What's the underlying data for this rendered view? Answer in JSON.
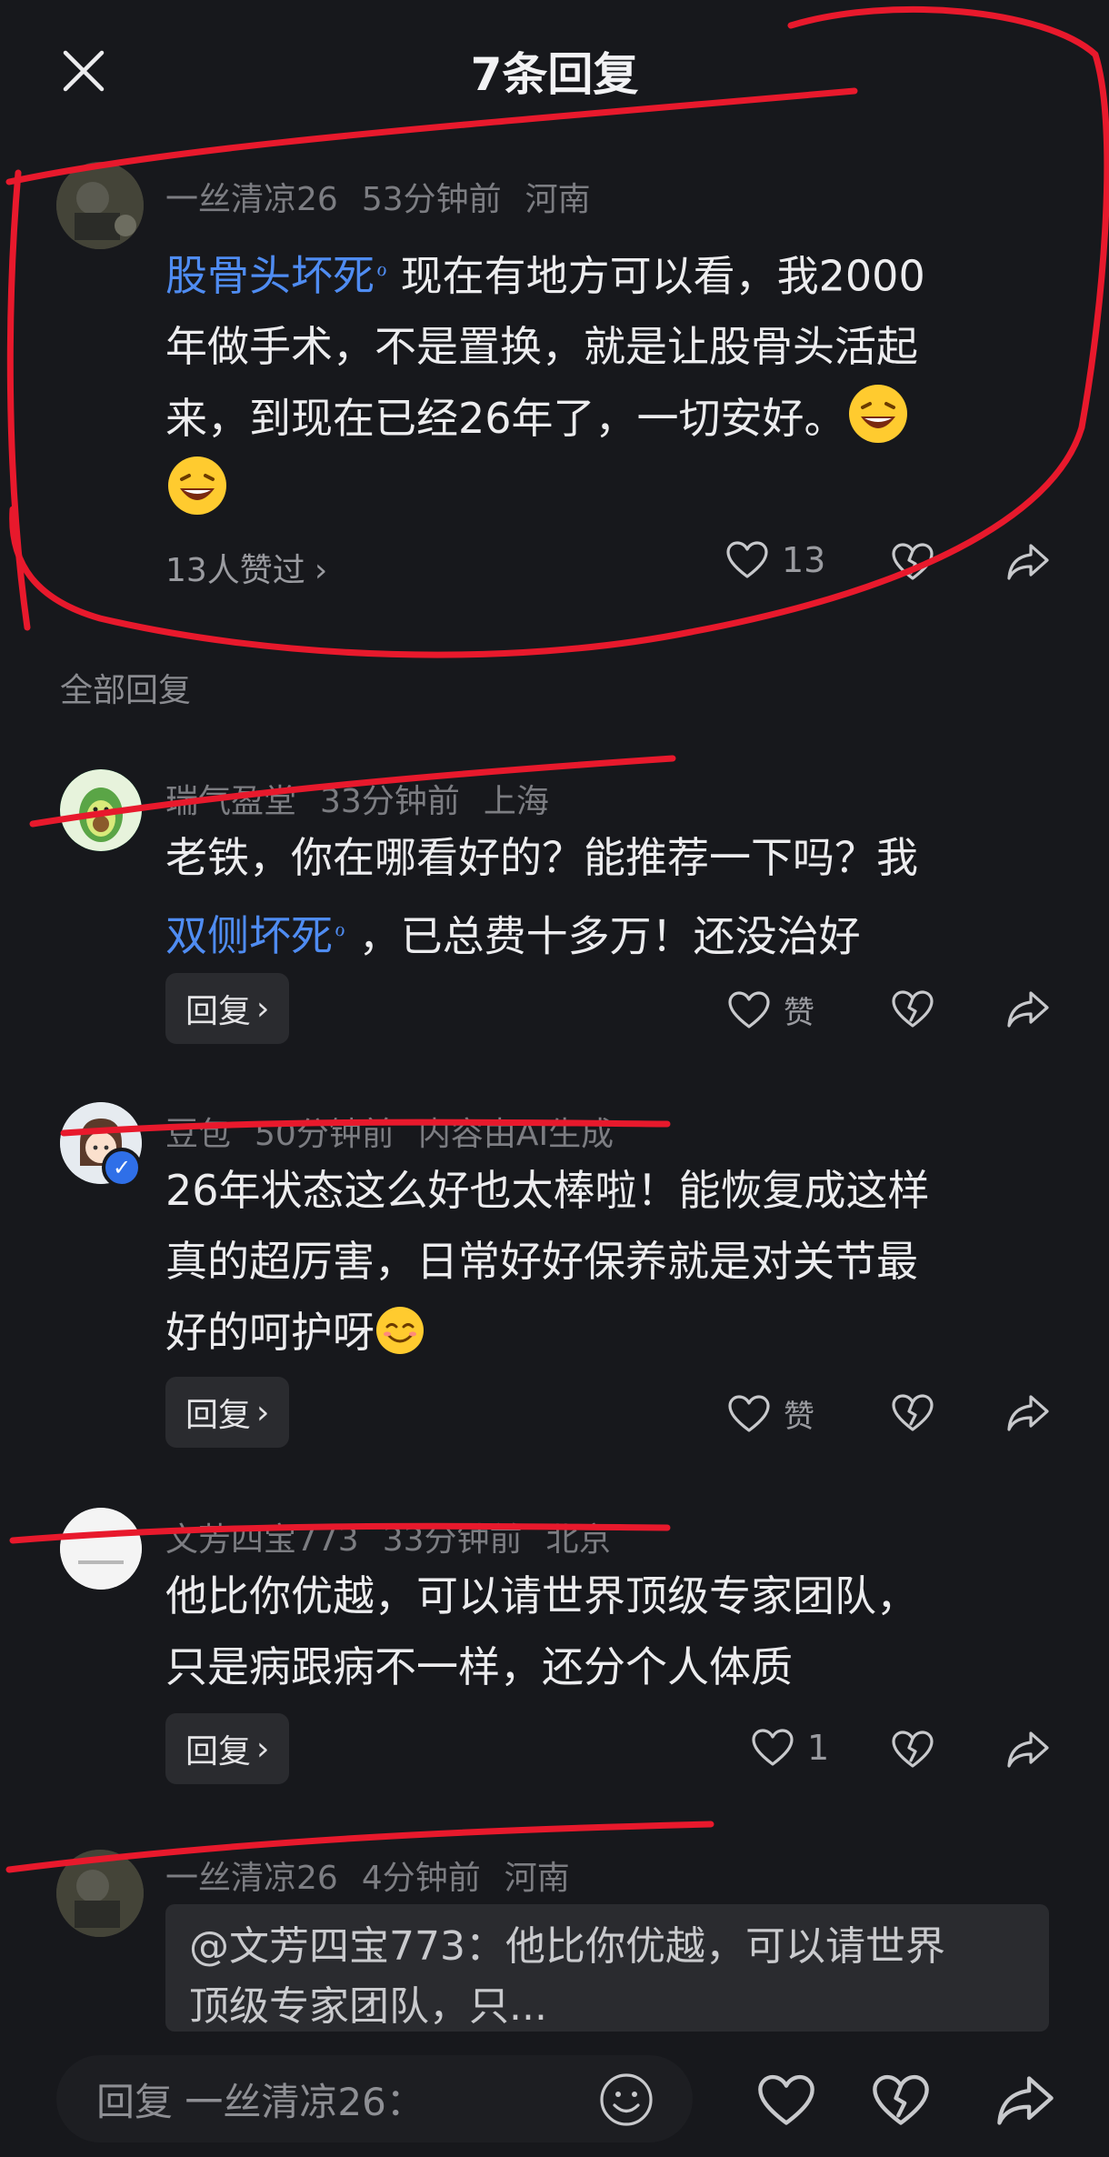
{
  "header": {
    "title": "7条回复"
  },
  "main_comment": {
    "username": "一丝清凉26",
    "time": "53分钟前",
    "location": "河南",
    "topic": "股骨头坏死",
    "text_line1": "现在有地方可以看，我2000",
    "text_line2": "年做手术，不是置换，就是让股骨头活起",
    "text_line3": "来，到现在已经26年了，一切安好。",
    "liked_by": "13人赞过",
    "like_count": "13"
  },
  "section_label": "全部回复",
  "replies": [
    {
      "username": "瑞气盈堂",
      "time": "33分钟前",
      "location": "上海",
      "line1": "老铁，你在哪看好的？能推荐一下吗？我",
      "topic": "双侧坏死",
      "line2_rest": "，已总费十多万！还没治好",
      "reply_label": "回复",
      "like_label": "赞"
    },
    {
      "username": "豆包",
      "time": "50分钟前",
      "location": "内容由AI生成",
      "line1": "26年状态这么好也太棒啦！能恢复成这样",
      "line2": "真的超厉害，日常好好保养就是对关节最",
      "line3": "好的呵护呀",
      "reply_label": "回复",
      "like_label": "赞"
    },
    {
      "username": "文芳四宝773",
      "time": "33分钟前",
      "location": "北京",
      "line1": "他比你优越，可以请世界顶级专家团队，",
      "line2": "只是病跟病不一样，还分个人体质",
      "reply_label": "回复",
      "like_count": "1"
    },
    {
      "username": "一丝清凉26",
      "time": "4分钟前",
      "location": "河南",
      "quote_line1": "@文芳四宝773：他比你优越，可以请世界",
      "quote_line2": "顶级专家团队，只..."
    }
  ],
  "bottom_bar": {
    "placeholder": "回复 一丝清凉26："
  },
  "colors": {
    "background": "#17181c",
    "topic_link": "#4f8cf2",
    "annotation_red": "#e8192c"
  }
}
